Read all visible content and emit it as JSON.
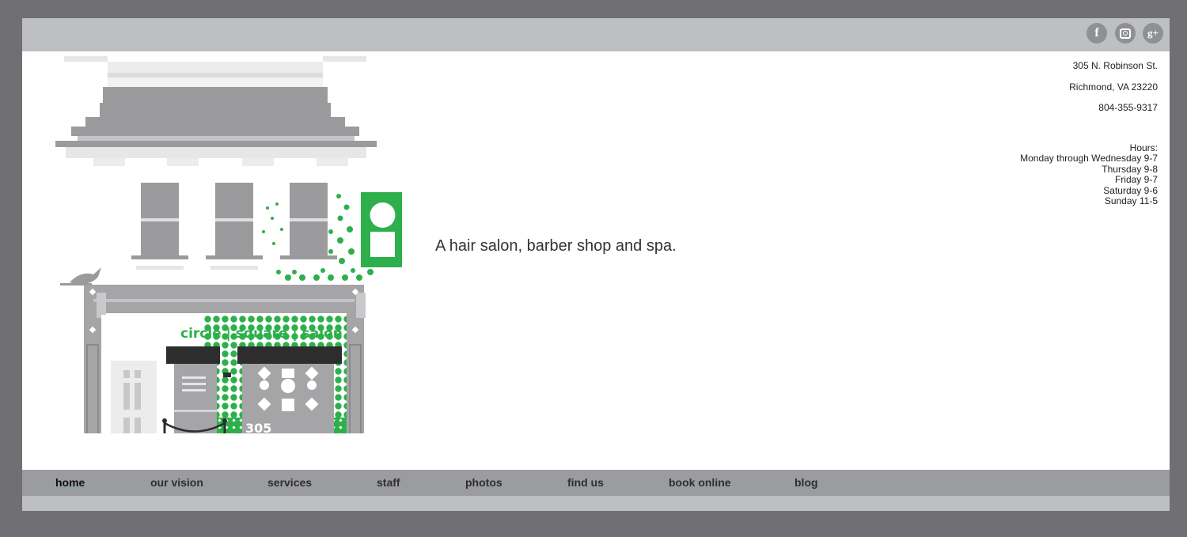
{
  "social": {
    "facebook_glyph": "f",
    "googleplus_glyph": "g+",
    "icons": [
      "facebook-icon",
      "instagram-icon",
      "google-plus-icon"
    ]
  },
  "illustration": {
    "sign_text": "circle | square | salon",
    "sign_word_1": "circle",
    "sign_word_2": "square",
    "sign_word_3": "salon",
    "sign_separator": "|",
    "street_number": "305"
  },
  "tagline": "A hair salon, barber shop and spa.",
  "contact": {
    "street": "305 N. Robinson St.",
    "city": "Richmond, VA 23220",
    "phone": "804-355-9317"
  },
  "hours": {
    "heading": "Hours:",
    "lines": [
      "Monday through Wednesday 9-7",
      "Thursday 9-8",
      "Friday 9-7",
      "Saturday 9-6",
      "Sunday 11-5"
    ]
  },
  "nav": {
    "items": [
      {
        "label": "home",
        "active": true
      },
      {
        "label": "our vision"
      },
      {
        "label": "services"
      },
      {
        "label": "staff"
      },
      {
        "label": "photos"
      },
      {
        "label": "find us"
      },
      {
        "label": "book online"
      },
      {
        "label": "blog"
      }
    ]
  },
  "colors": {
    "brand_green": "#2db04b",
    "page_border": "#6f6f74",
    "bar_light": "#bebfc3",
    "nav_bar": "#9b9ca0"
  }
}
